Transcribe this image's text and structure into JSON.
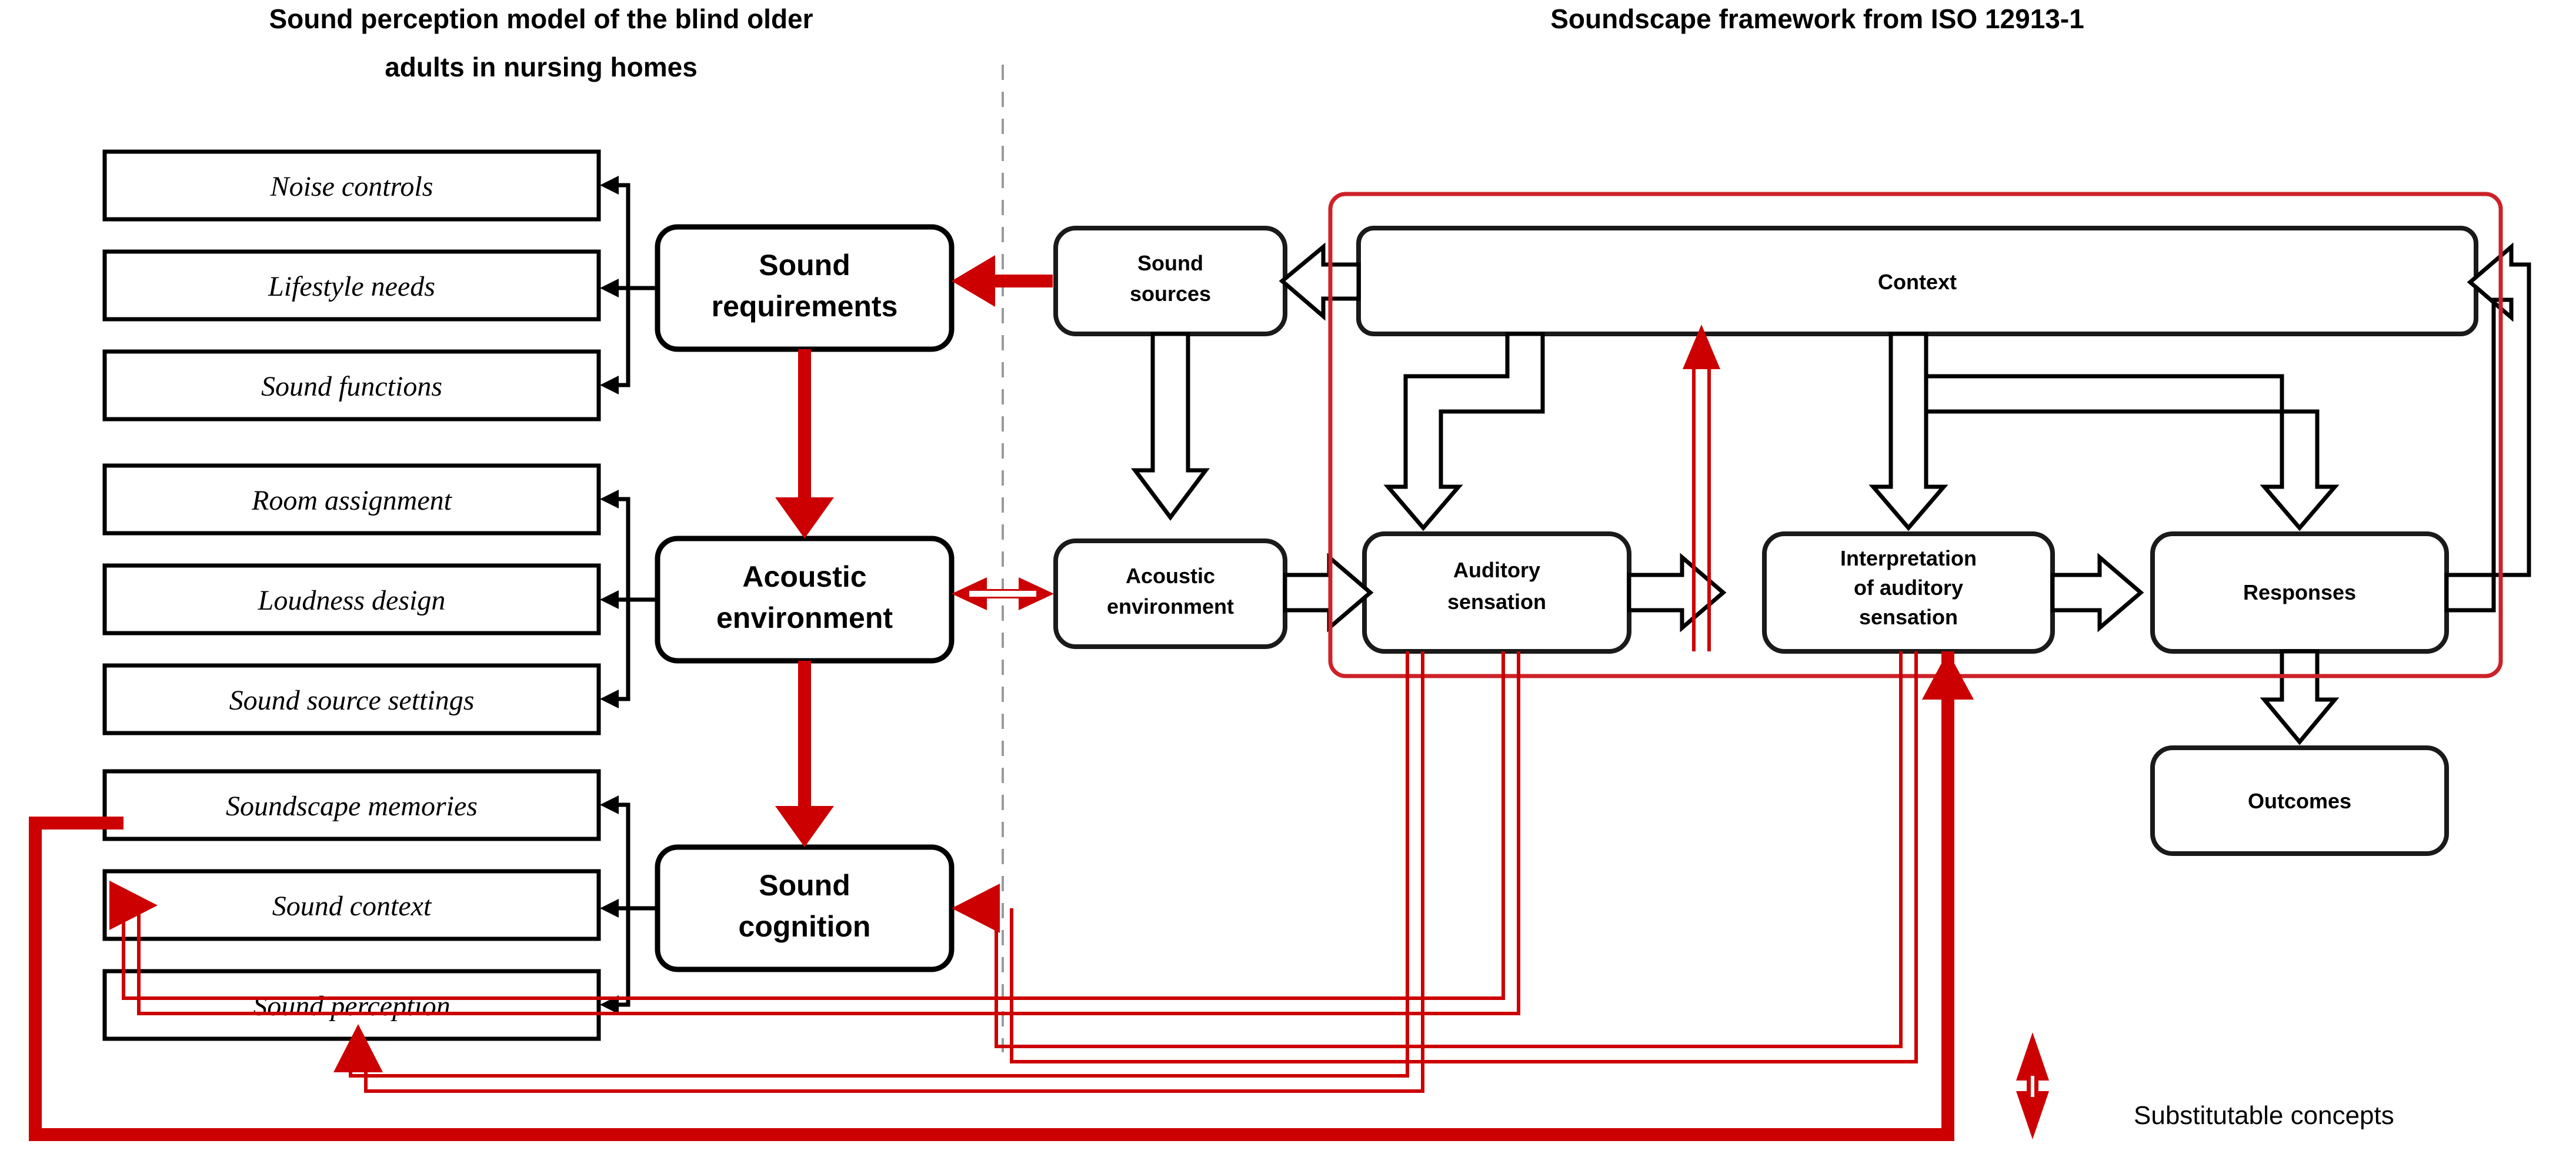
{
  "titles": {
    "left": "Sound perception model of the blind older adults in nursing homes",
    "left_line1": "Sound perception model of the blind older",
    "left_line2": "adults in nursing homes",
    "right": "Soundscape framework from ISO 12913-1"
  },
  "left_model": {
    "groups": [
      {
        "hub": {
          "line1": "Sound",
          "line2": "requirements",
          "label": "Sound requirements"
        },
        "items": [
          "Noise controls",
          "Lifestyle needs",
          "Sound functions"
        ]
      },
      {
        "hub": {
          "line1": "Acoustic",
          "line2": "environment",
          "label": "Acoustic environment"
        },
        "items": [
          "Room assignment",
          "Loudness design",
          "Sound source settings"
        ]
      },
      {
        "hub": {
          "line1": "Sound",
          "line2": "cognition",
          "label": "Sound cognition"
        },
        "items": [
          "Soundscape memories",
          "Sound context",
          "Sound perception"
        ]
      }
    ]
  },
  "iso_framework": {
    "nodes": [
      {
        "id": "sound-sources",
        "line1": "Sound",
        "line2": "sources",
        "label": "Sound sources"
      },
      {
        "id": "acoustic-environment",
        "line1": "Acoustic",
        "line2": "environment",
        "label": "Acoustic environment"
      },
      {
        "id": "context",
        "line1": "Context",
        "line2": "",
        "label": "Context"
      },
      {
        "id": "auditory-sensation",
        "line1": "Auditory",
        "line2": "sensation",
        "label": "Auditory sensation"
      },
      {
        "id": "interpretation-of-auditory-sensation",
        "line1": "Interpretation",
        "line2": "of auditory",
        "line3": "sensation",
        "label": "Interpretation of auditory sensation"
      },
      {
        "id": "responses",
        "line1": "Responses",
        "line2": "",
        "label": "Responses"
      },
      {
        "id": "outcomes",
        "line1": "Outcomes",
        "line2": "",
        "label": "Outcomes"
      }
    ]
  },
  "legend": {
    "label": "Substitutable concepts",
    "icon": "red-double-headed-vertical-arrow"
  },
  "colors": {
    "accent_red": "#cc0000",
    "outline_red": "#cc2229",
    "black": "#000000",
    "divider_gray": "#9a9a9a",
    "background": "#ffffff"
  }
}
